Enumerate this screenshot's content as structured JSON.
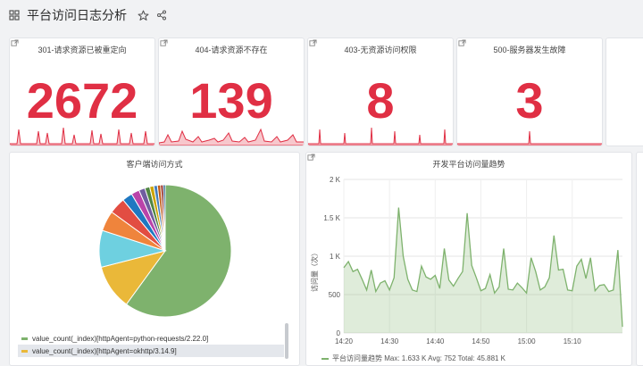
{
  "header": {
    "title": "平台访问日志分析"
  },
  "stats": [
    {
      "title": "301-请求资源已被重定向",
      "value": "2672"
    },
    {
      "title": "404-请求资源不存在",
      "value": "139"
    },
    {
      "title": "403-无资源访问权限",
      "value": "8"
    },
    {
      "title": "500-服务器发生故障",
      "value": "3"
    }
  ],
  "pie_panel": {
    "title": "客户端访问方式",
    "legend": [
      {
        "label": "value_count(_index)[httpAgent=python-requests/2.22.0]",
        "color": "#7eb26d"
      },
      {
        "label": "value_count(_index)[httpAgent=okhttp/3.14.9]",
        "color": "#eab839"
      }
    ]
  },
  "line_panel": {
    "title": "开发平台访问量趋势",
    "ylabel": "访问量（次）",
    "legend_text": "平台访问量趋势  Max: 1.633 K  Avg: 752  Total: 45.881 K"
  },
  "colors": {
    "accent": "#e02f44",
    "series": "#7eb26d"
  },
  "chart_data": [
    {
      "type": "pie",
      "title": "客户端访问方式",
      "slices": [
        {
          "value": 60,
          "color": "#7eb26d"
        },
        {
          "value": 11,
          "color": "#eab839"
        },
        {
          "value": 9,
          "color": "#6ed0e0"
        },
        {
          "value": 5,
          "color": "#ef843c"
        },
        {
          "value": 4,
          "color": "#e24d42"
        },
        {
          "value": 2.5,
          "color": "#1f78c1"
        },
        {
          "value": 2,
          "color": "#ba43a9"
        },
        {
          "value": 1.5,
          "color": "#705da0"
        },
        {
          "value": 1.2,
          "color": "#508642"
        },
        {
          "value": 1,
          "color": "#cca300"
        },
        {
          "value": 0.9,
          "color": "#447ebc"
        },
        {
          "value": 0.8,
          "color": "#c15c17"
        },
        {
          "value": 0.6,
          "color": "#890f02"
        },
        {
          "value": 0.5,
          "color": "#0a437c"
        }
      ]
    },
    {
      "type": "area",
      "title": "开发平台访问量趋势",
      "xlabel": "",
      "ylabel": "访问量（次）",
      "ylim": [
        0,
        2000
      ],
      "yticks": [
        "0",
        "500",
        "1 K",
        "1.5 K",
        "2 K"
      ],
      "xticks": [
        "14:20",
        "14:30",
        "14:40",
        "14:50",
        "15:00",
        "15:10"
      ],
      "x_minutes": [
        0,
        1,
        2,
        3,
        4,
        5,
        6,
        7,
        8,
        9,
        10,
        11,
        12,
        13,
        14,
        15,
        16,
        17,
        18,
        19,
        20,
        21,
        22,
        23,
        24,
        25,
        26,
        27,
        28,
        29,
        30,
        31,
        32,
        33,
        34,
        35,
        36,
        37,
        38,
        39,
        40,
        41,
        42,
        43,
        44,
        45,
        46,
        47,
        48,
        49,
        50,
        51,
        52,
        53,
        54,
        55,
        56,
        57,
        58,
        59,
        60,
        61
      ],
      "series": [
        {
          "values": [
            850,
            930,
            800,
            830,
            700,
            560,
            820,
            540,
            650,
            680,
            560,
            720,
            1633,
            1000,
            700,
            560,
            540,
            870,
            730,
            700,
            750,
            580,
            1100,
            690,
            610,
            710,
            800,
            1560,
            880,
            720,
            550,
            580,
            760,
            520,
            600,
            1100,
            570,
            560,
            650,
            590,
            520,
            980,
            800,
            560,
            600,
            720,
            1270,
            820,
            830,
            560,
            550,
            870,
            960,
            710,
            980,
            550,
            620,
            630,
            540,
            560,
            1080,
            80
          ]
        }
      ]
    }
  ]
}
